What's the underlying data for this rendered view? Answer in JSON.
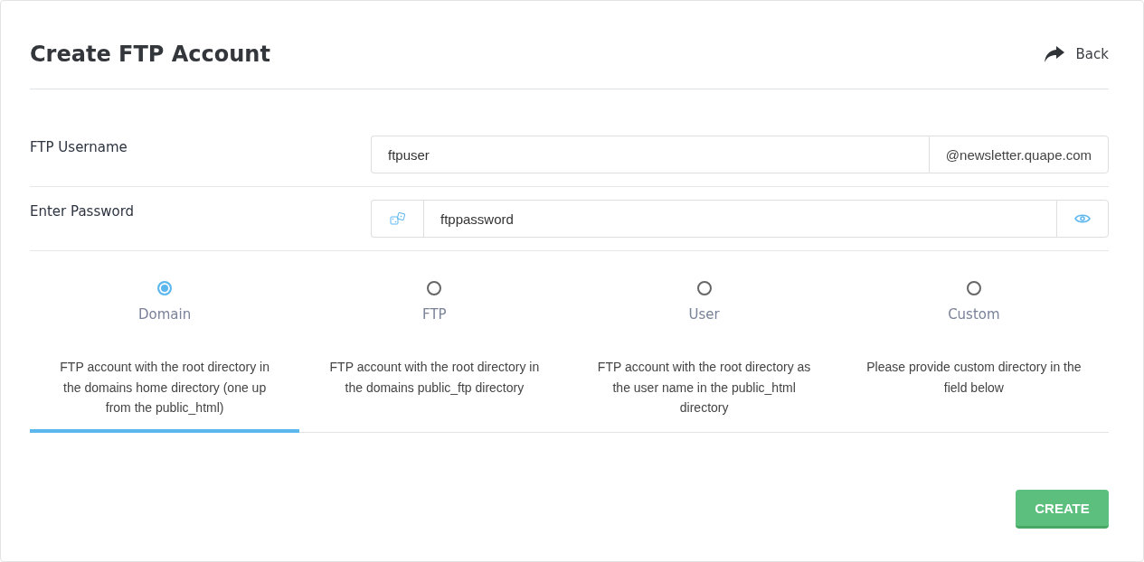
{
  "title": "Create FTP Account",
  "back_link": "Back",
  "username": {
    "label": "FTP Username",
    "value": "ftpuser",
    "domain_suffix": "@newsletter.quape.com"
  },
  "password": {
    "label": "Enter Password",
    "value": "ftppassword"
  },
  "directory_options": [
    {
      "label": "Domain",
      "description": "FTP account with the root directory in the domains home directory (one up from the public_html)",
      "selected": true
    },
    {
      "label": "FTP",
      "description": "FTP account with the root directory in the domains public_ftp directory",
      "selected": false
    },
    {
      "label": "User",
      "description": "FTP account with the root directory as the user name in the public_html directory",
      "selected": false
    },
    {
      "label": "Custom",
      "description": "Please provide custom directory in the field below",
      "selected": false
    }
  ],
  "create_button": "CREATE"
}
